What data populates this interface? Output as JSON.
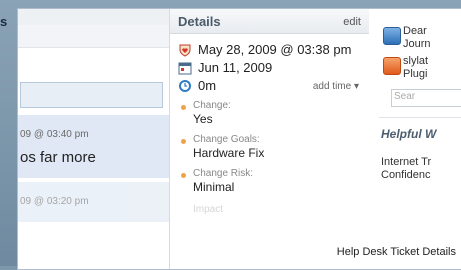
{
  "sidebar_title": "s",
  "left_pane": {
    "messages": [
      {
        "timestamp": "09 @ 03:40 pm",
        "snippet": "os far more"
      },
      {
        "timestamp": "09 @ 03:20 pm",
        "snippet": ""
      }
    ]
  },
  "details": {
    "title": "Details",
    "edit_label": "edit",
    "created": "May 28, 2009 @ 03:38 pm",
    "due": "Jun 11, 2009",
    "time_spent": "0m",
    "add_time_label": "add time",
    "changes": [
      {
        "label": "Change:",
        "value": "Yes"
      },
      {
        "label": "Change Goals:",
        "value": "Hardware Fix"
      },
      {
        "label": "Change Risk:",
        "value": "Minimal"
      },
      {
        "label": "Impact",
        "value": ""
      }
    ]
  },
  "right_pane": {
    "items": [
      {
        "icon": "app-blue-icon",
        "line1": "Dear",
        "line2": "Journ"
      },
      {
        "icon": "app-orange-icon",
        "line1": "slylat",
        "line2": "Plugi"
      }
    ],
    "search_placeholder": "Sear",
    "helpful_heading": "Helpful W",
    "links": [
      {
        "line1": "Internet Tr",
        "line2": "Confidenc"
      }
    ]
  },
  "caption": "Help Desk Ticket Details",
  "colors": {
    "accent_bullet": "#f0a24a",
    "background": "#7d97ab"
  }
}
